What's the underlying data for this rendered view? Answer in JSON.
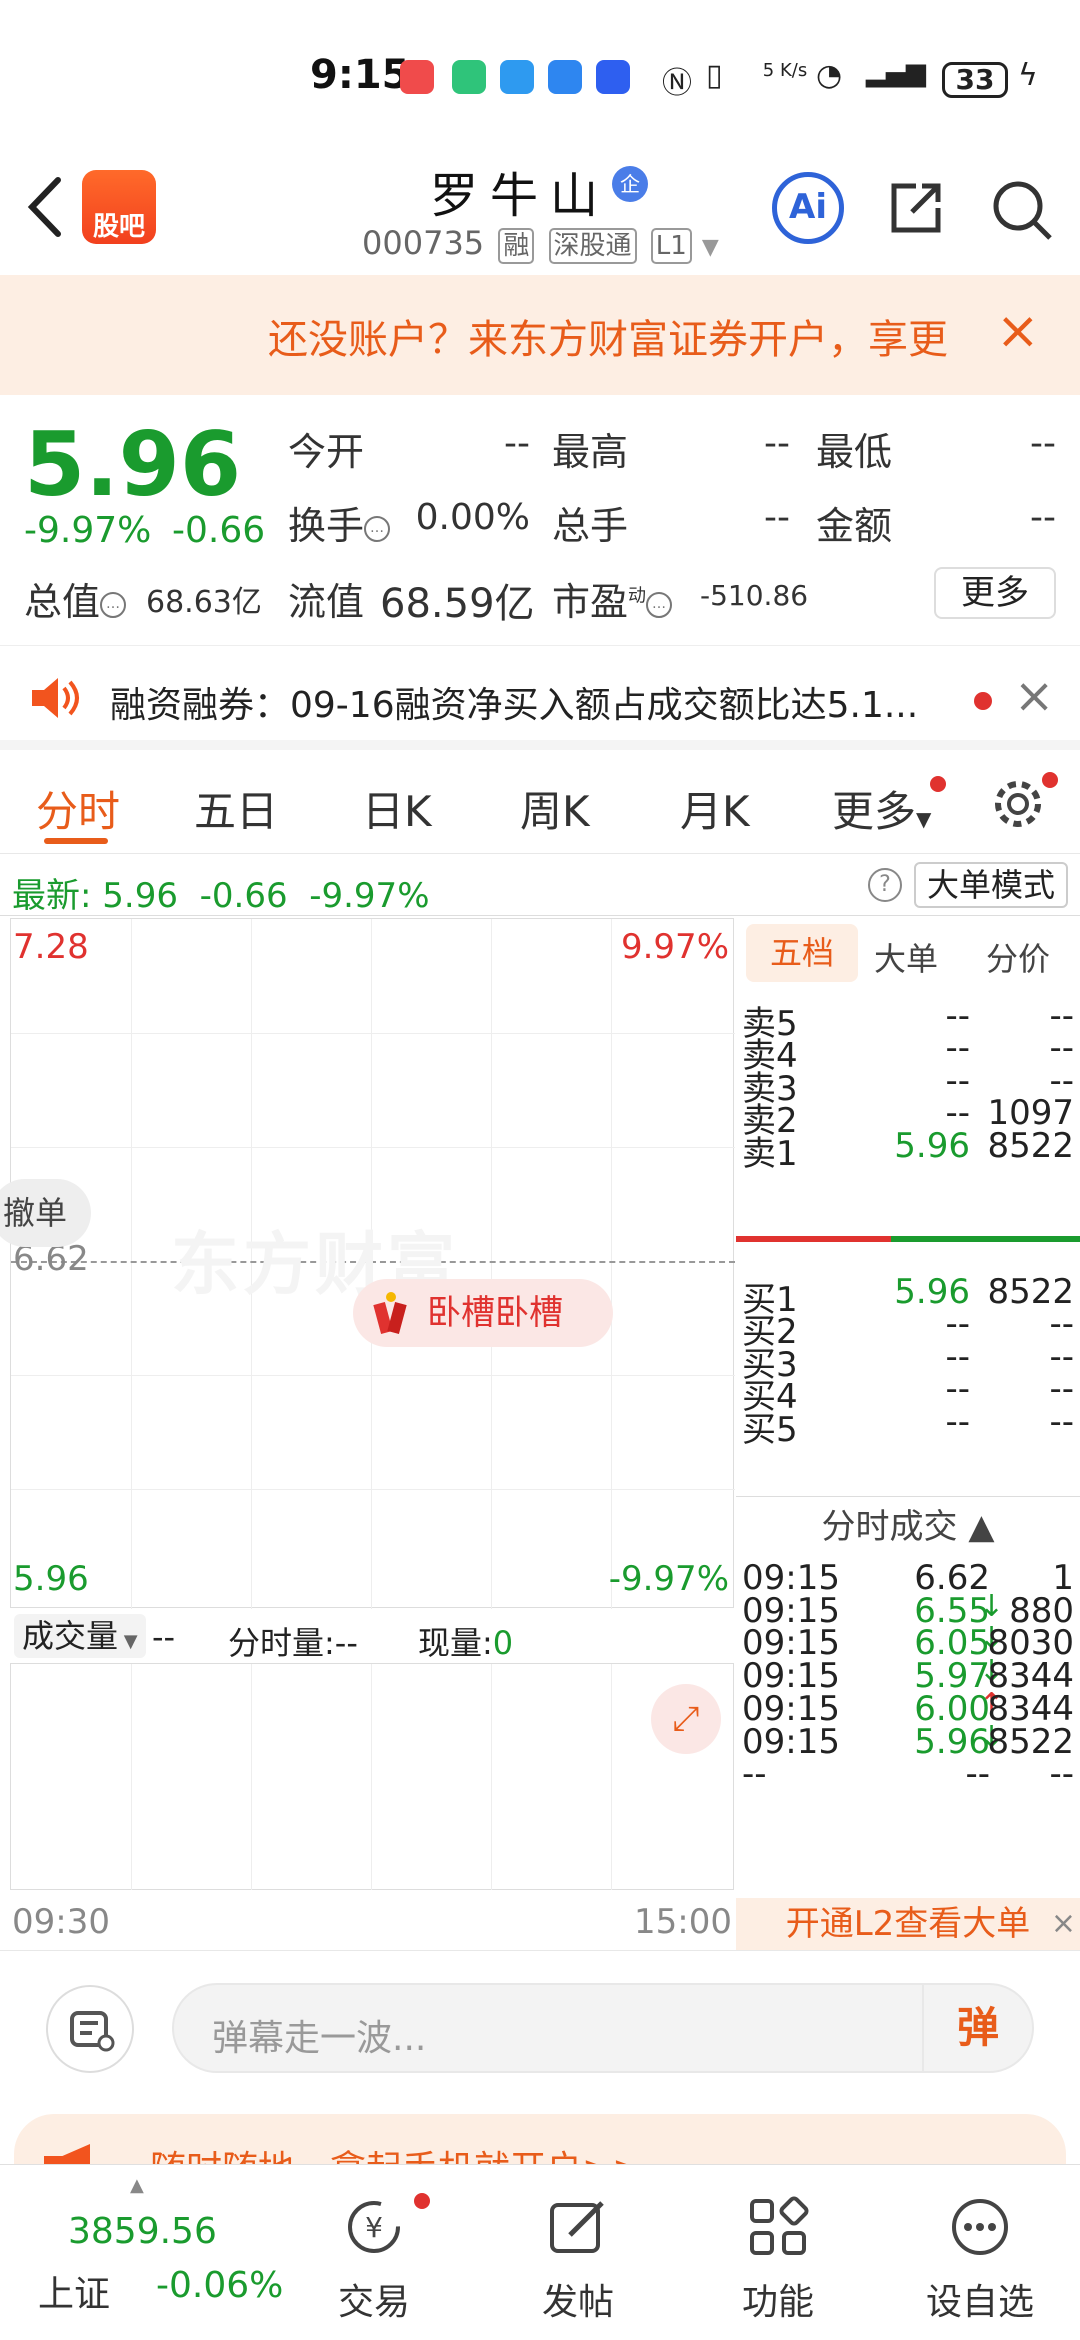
{
  "status": {
    "time": "9:15",
    "net_speed": "5 K/s",
    "battery": "33"
  },
  "header": {
    "guba_label": "股吧",
    "stock_name": "罗牛山",
    "badge_qi": "企",
    "code": "000735",
    "tags": [
      "融",
      "深股通",
      "L1"
    ],
    "ai_label": "Ai"
  },
  "banner": {
    "text": "还没账户？来东方财富证券开户，享更",
    "close": "×"
  },
  "quote": {
    "price": "5.96",
    "pct": "-9.97%",
    "change": "-0.66",
    "labels": {
      "open": "今开",
      "high": "最高",
      "low": "最低",
      "turnover": "换手",
      "volume": "总手",
      "amount": "金额",
      "mktcap": "总值",
      "float": "流值",
      "pe": "市盈",
      "pe_sup": "动"
    },
    "values": {
      "open": "--",
      "high": "--",
      "low": "--",
      "turnover": "0.00%",
      "volume": "--",
      "amount": "--",
      "mktcap": "68.63亿",
      "float": "68.59亿",
      "pe": "-510.86"
    },
    "more_label": "更多"
  },
  "notice": {
    "text": "融资融券：09-16融资净买入额占成交额比达5.1..."
  },
  "tabs": [
    "分时",
    "五日",
    "日K",
    "周K",
    "月K",
    "更多"
  ],
  "latest": {
    "label": "最新:",
    "price": "5.96",
    "change": "-0.66",
    "pct": "-9.97%",
    "help": "?",
    "big_mode": "大单模式"
  },
  "chart": {
    "top_price": "7.28",
    "top_pct": "9.97%",
    "mid_price": "6.62",
    "bottom_price": "5.96",
    "bottom_pct": "-9.97%",
    "watermark": "东方财富",
    "bubble": "卧槽卧槽",
    "side_bubble": "撤单",
    "vol_selector": "成交量",
    "vol_value": "--",
    "min_vol_label": "分时量:--",
    "cur_vol_label": "现量:",
    "cur_vol_value": "0",
    "time_start": "09:30",
    "time_end": "15:00"
  },
  "orderbook": {
    "tabs": [
      "五档",
      "大单",
      "分价"
    ],
    "asks": [
      {
        "label": "卖5",
        "price": "--",
        "vol": "--"
      },
      {
        "label": "卖4",
        "price": "--",
        "vol": "--"
      },
      {
        "label": "卖3",
        "price": "--",
        "vol": "--"
      },
      {
        "label": "卖2",
        "price": "--",
        "vol": "1097"
      },
      {
        "label": "卖1",
        "price": "5.96",
        "vol": "8522"
      }
    ],
    "bids": [
      {
        "label": "买1",
        "price": "5.96",
        "vol": "8522"
      },
      {
        "label": "买2",
        "price": "--",
        "vol": "--"
      },
      {
        "label": "买3",
        "price": "--",
        "vol": "--"
      },
      {
        "label": "买4",
        "price": "--",
        "vol": "--"
      },
      {
        "label": "买5",
        "price": "--",
        "vol": "--"
      }
    ]
  },
  "trades": {
    "title": "分时成交 ▲",
    "rows": [
      {
        "time": "09:15",
        "price": "6.62",
        "arrow": "",
        "vol": "1",
        "color": "#222222"
      },
      {
        "time": "09:15",
        "price": "6.55",
        "arrow": "↓",
        "vol": "880",
        "color": "#1a9b2e"
      },
      {
        "time": "09:15",
        "price": "6.05",
        "arrow": "↓",
        "vol": "8030",
        "color": "#1a9b2e"
      },
      {
        "time": "09:15",
        "price": "5.97",
        "arrow": "↓",
        "vol": "8344",
        "color": "#1a9b2e"
      },
      {
        "time": "09:15",
        "price": "6.00",
        "arrow": "↑",
        "vol": "8344",
        "color": "#1a9b2e"
      },
      {
        "time": "09:15",
        "price": "5.96",
        "arrow": "↓",
        "vol": "8522",
        "color": "#1a9b2e"
      },
      {
        "time": "--",
        "price": "--",
        "arrow": "",
        "vol": "--",
        "color": "#222222"
      }
    ],
    "l2_label": "开通L2查看大单"
  },
  "comment": {
    "placeholder": "弹幕走一波...",
    "danmu": "弹"
  },
  "promo": {
    "text": "随时随地，拿起手机就开户>>"
  },
  "bottom_nav": {
    "index_value": "3859.56",
    "index_name": "上证",
    "index_pct": "-0.06%",
    "items": [
      "交易",
      "发帖",
      "功能",
      "设自选"
    ]
  },
  "colors": {
    "up": "#e0322f",
    "down": "#1a9b2e",
    "accent": "#e85c1a"
  }
}
